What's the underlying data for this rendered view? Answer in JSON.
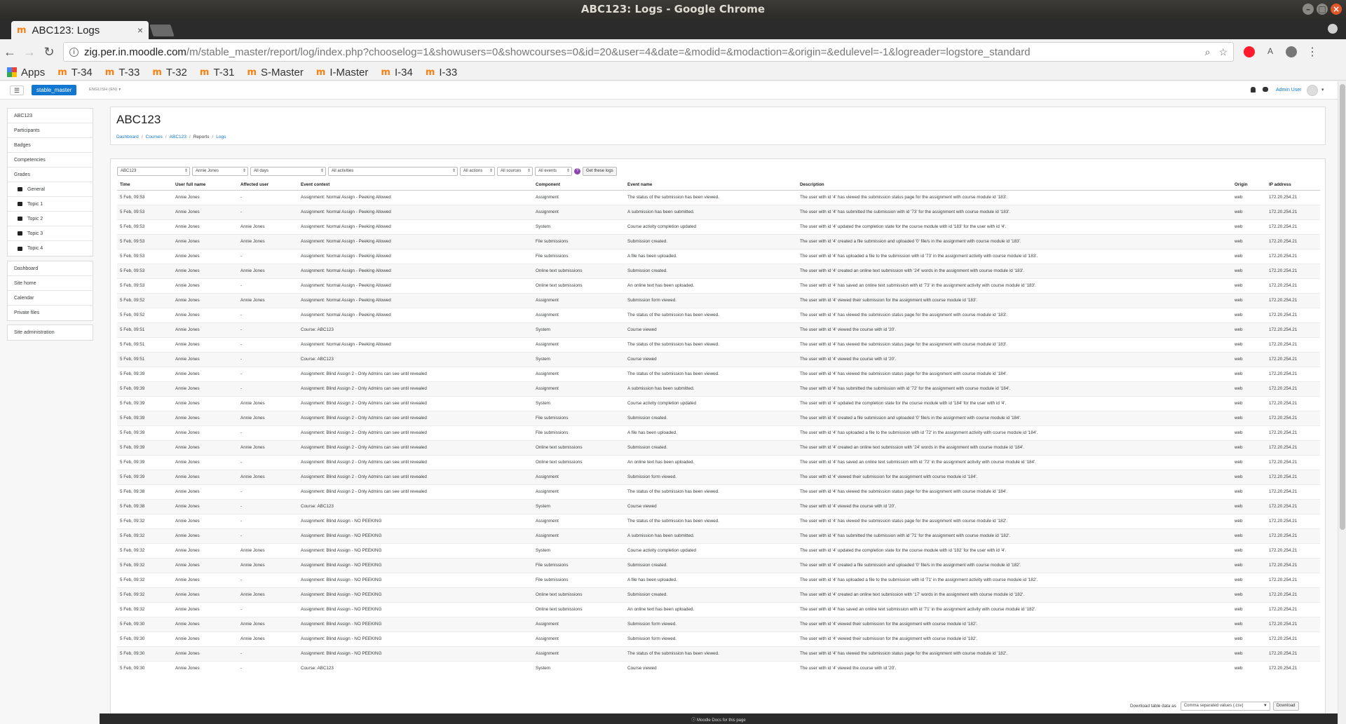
{
  "window": {
    "title": "ABC123: Logs - Google Chrome"
  },
  "tab": {
    "title": "ABC123: Logs",
    "favicon": "moodle-icon",
    "close": "×"
  },
  "toolbar": {
    "url_host": "zig.per.in.moodle.com",
    "url_path": "/m/stable_master/report/log/index.php?chooselog=1&showusers=0&showcourses=0&id=20&user=4&date=&modid=&modaction=&origin=&edulevel=-1&logreader=logstore_standard"
  },
  "bookmarks": [
    "T-34",
    "T-33",
    "T-32",
    "T-31",
    "S-Master",
    "I-Master",
    "I-34",
    "I-33"
  ],
  "bookmarks_apps": "Apps",
  "moodle": {
    "site_name": "stable_master",
    "language": "ENGLISH (EN)",
    "user": "Admin User"
  },
  "sidebar": {
    "course": [
      "ABC123",
      "Participants",
      "Badges",
      "Competencies",
      "Grades"
    ],
    "sections": [
      "General",
      "Topic 1",
      "Topic 2",
      "Topic 3",
      "Topic 4"
    ],
    "nav": [
      "Dashboard",
      "Site home",
      "Calendar",
      "Private files"
    ],
    "admin": "Site administration"
  },
  "header": {
    "title": "ABC123",
    "breadcrumb": [
      {
        "label": "Dashboard",
        "link": true
      },
      {
        "label": "Courses",
        "link": true
      },
      {
        "label": "ABC123",
        "link": true
      },
      {
        "label": "Reports",
        "link": false
      },
      {
        "label": "Logs",
        "link": true
      }
    ]
  },
  "filters": {
    "course": "ABC123",
    "user": "Annie Jones",
    "date": "All days",
    "activity": "All activities",
    "actions": "All actions",
    "sources": "All sources",
    "events": "All events",
    "submit": "Get these logs"
  },
  "table": {
    "columns": [
      "Time",
      "User full name",
      "Affected user",
      "Event context",
      "Component",
      "Event name",
      "Description",
      "Origin",
      "IP address"
    ],
    "rows": [
      [
        "5 Feb, 09:53",
        "Annie Jones",
        "-",
        "Assignment: Normal Assign - Peeking Allowed",
        "Assignment",
        "The status of the submission has been viewed.",
        "The user with id '4' has viewed the submission status page for the assignment with course module id '183'.",
        "web",
        "172.20.254.21"
      ],
      [
        "5 Feb, 09:53",
        "Annie Jones",
        "-",
        "Assignment: Normal Assign - Peeking Allowed",
        "Assignment",
        "A submission has been submitted.",
        "The user with id '4' has submitted the submission with id '73' for the assignment with course module id '183'.",
        "web",
        "172.20.254.21"
      ],
      [
        "5 Feb, 09:53",
        "Annie Jones",
        "Annie Jones",
        "Assignment: Normal Assign - Peeking Allowed",
        "System",
        "Course activity completion updated",
        "The user with id '4' updated the completion state for the course module with id '183' for the user with id '4'.",
        "web",
        "172.20.254.21"
      ],
      [
        "5 Feb, 09:53",
        "Annie Jones",
        "Annie Jones",
        "Assignment: Normal Assign - Peeking Allowed",
        "File submissions",
        "Submission created.",
        "The user with id '4' created a file submission and uploaded '0' file/s in the assignment with course module id '183'.",
        "web",
        "172.20.254.21"
      ],
      [
        "5 Feb, 09:53",
        "Annie Jones",
        "-",
        "Assignment: Normal Assign - Peeking Allowed",
        "File submissions",
        "A file has been uploaded.",
        "The user with id '4' has uploaded a file to the submission with id '73' in the assignment activity with course module id '183'.",
        "web",
        "172.20.254.21"
      ],
      [
        "5 Feb, 09:53",
        "Annie Jones",
        "Annie Jones",
        "Assignment: Normal Assign - Peeking Allowed",
        "Online text submissions",
        "Submission created.",
        "The user with id '4' created an online text submission with '24' words in the assignment with course module id '183'.",
        "web",
        "172.20.254.21"
      ],
      [
        "5 Feb, 09:53",
        "Annie Jones",
        "-",
        "Assignment: Normal Assign - Peeking Allowed",
        "Online text submissions",
        "An online text has been uploaded.",
        "The user with id '4' has saved an online text submission with id '73' in the assignment activity with course module id '183'.",
        "web",
        "172.20.254.21"
      ],
      [
        "5 Feb, 09:52",
        "Annie Jones",
        "Annie Jones",
        "Assignment: Normal Assign - Peeking Allowed",
        "Assignment",
        "Submission form viewed.",
        "The user with id '4' viewed their submission for the assignment with course module id '183'.",
        "web",
        "172.20.254.21"
      ],
      [
        "5 Feb, 09:52",
        "Annie Jones",
        "-",
        "Assignment: Normal Assign - Peeking Allowed",
        "Assignment",
        "The status of the submission has been viewed.",
        "The user with id '4' has viewed the submission status page for the assignment with course module id '183'.",
        "web",
        "172.20.254.21"
      ],
      [
        "5 Feb, 09:51",
        "Annie Jones",
        "-",
        "Course: ABC123",
        "System",
        "Course viewed",
        "The user with id '4' viewed the course with id '20'.",
        "web",
        "172.20.254.21"
      ],
      [
        "5 Feb, 09:51",
        "Annie Jones",
        "-",
        "Assignment: Normal Assign - Peeking Allowed",
        "Assignment",
        "The status of the submission has been viewed.",
        "The user with id '4' has viewed the submission status page for the assignment with course module id '183'.",
        "web",
        "172.20.254.21"
      ],
      [
        "5 Feb, 09:51",
        "Annie Jones",
        "-",
        "Course: ABC123",
        "System",
        "Course viewed",
        "The user with id '4' viewed the course with id '20'.",
        "web",
        "172.20.254.21"
      ],
      [
        "5 Feb, 09:39",
        "Annie Jones",
        "-",
        "Assignment: Blind Assign 2 - Only Admins can see until revealed",
        "Assignment",
        "The status of the submission has been viewed.",
        "The user with id '4' has viewed the submission status page for the assignment with course module id '184'.",
        "web",
        "172.20.254.21"
      ],
      [
        "5 Feb, 09:39",
        "Annie Jones",
        "-",
        "Assignment: Blind Assign 2 - Only Admins can see until revealed",
        "Assignment",
        "A submission has been submitted.",
        "The user with id '4' has submitted the submission with id '72' for the assignment with course module id '184'.",
        "web",
        "172.20.254.21"
      ],
      [
        "5 Feb, 09:39",
        "Annie Jones",
        "Annie Jones",
        "Assignment: Blind Assign 2 - Only Admins can see until revealed",
        "System",
        "Course activity completion updated",
        "The user with id '4' updated the completion state for the course module with id '184' for the user with id '4'.",
        "web",
        "172.20.254.21"
      ],
      [
        "5 Feb, 09:39",
        "Annie Jones",
        "Annie Jones",
        "Assignment: Blind Assign 2 - Only Admins can see until revealed",
        "File submissions",
        "Submission created.",
        "The user with id '4' created a file submission and uploaded '0' file/s in the assignment with course module id '184'.",
        "web",
        "172.20.254.21"
      ],
      [
        "5 Feb, 09:39",
        "Annie Jones",
        "-",
        "Assignment: Blind Assign 2 - Only Admins can see until revealed",
        "File submissions",
        "A file has been uploaded.",
        "The user with id '4' has uploaded a file to the submission with id '72' in the assignment activity with course module id '184'.",
        "web",
        "172.20.254.21"
      ],
      [
        "5 Feb, 09:39",
        "Annie Jones",
        "Annie Jones",
        "Assignment: Blind Assign 2 - Only Admins can see until revealed",
        "Online text submissions",
        "Submission created.",
        "The user with id '4' created an online text submission with '24' words in the assignment with course module id '184'.",
        "web",
        "172.20.254.21"
      ],
      [
        "5 Feb, 09:39",
        "Annie Jones",
        "-",
        "Assignment: Blind Assign 2 - Only Admins can see until revealed",
        "Online text submissions",
        "An online text has been uploaded.",
        "The user with id '4' has saved an online text submission with id '72' in the assignment activity with course module id '184'.",
        "web",
        "172.20.254.21"
      ],
      [
        "5 Feb, 09:39",
        "Annie Jones",
        "Annie Jones",
        "Assignment: Blind Assign 2 - Only Admins can see until revealed",
        "Assignment",
        "Submission form viewed.",
        "The user with id '4' viewed their submission for the assignment with course module id '184'.",
        "web",
        "172.20.254.21"
      ],
      [
        "5 Feb, 09:38",
        "Annie Jones",
        "-",
        "Assignment: Blind Assign 2 - Only Admins can see until revealed",
        "Assignment",
        "The status of the submission has been viewed.",
        "The user with id '4' has viewed the submission status page for the assignment with course module id '184'.",
        "web",
        "172.20.254.21"
      ],
      [
        "5 Feb, 09:38",
        "Annie Jones",
        "-",
        "Course: ABC123",
        "System",
        "Course viewed",
        "The user with id '4' viewed the course with id '20'.",
        "web",
        "172.20.254.21"
      ],
      [
        "5 Feb, 09:32",
        "Annie Jones",
        "-",
        "Assignment: Blind Assign - NO PEEKING",
        "Assignment",
        "The status of the submission has been viewed.",
        "The user with id '4' has viewed the submission status page for the assignment with course module id '182'.",
        "web",
        "172.20.254.21"
      ],
      [
        "5 Feb, 09:32",
        "Annie Jones",
        "-",
        "Assignment: Blind Assign - NO PEEKING",
        "Assignment",
        "A submission has been submitted.",
        "The user with id '4' has submitted the submission with id '71' for the assignment with course module id '182'.",
        "web",
        "172.20.254.21"
      ],
      [
        "5 Feb, 09:32",
        "Annie Jones",
        "Annie Jones",
        "Assignment: Blind Assign - NO PEEKING",
        "System",
        "Course activity completion updated",
        "The user with id '4' updated the completion state for the course module with id '182' for the user with id '4'.",
        "web",
        "172.20.254.21"
      ],
      [
        "5 Feb, 09:32",
        "Annie Jones",
        "Annie Jones",
        "Assignment: Blind Assign - NO PEEKING",
        "File submissions",
        "Submission created.",
        "The user with id '4' created a file submission and uploaded '0' file/s in the assignment with course module id '182'.",
        "web",
        "172.20.254.21"
      ],
      [
        "5 Feb, 09:32",
        "Annie Jones",
        "-",
        "Assignment: Blind Assign - NO PEEKING",
        "File submissions",
        "A file has been uploaded.",
        "The user with id '4' has uploaded a file to the submission with id '71' in the assignment activity with course module id '182'.",
        "web",
        "172.20.254.21"
      ],
      [
        "5 Feb, 09:32",
        "Annie Jones",
        "Annie Jones",
        "Assignment: Blind Assign - NO PEEKING",
        "Online text submissions",
        "Submission created.",
        "The user with id '4' created an online text submission with '17' words in the assignment with course module id '182'.",
        "web",
        "172.20.254.21"
      ],
      [
        "5 Feb, 09:32",
        "Annie Jones",
        "-",
        "Assignment: Blind Assign - NO PEEKING",
        "Online text submissions",
        "An online text has been uploaded.",
        "The user with id '4' has saved an online text submission with id '71' in the assignment activity with course module id '182'.",
        "web",
        "172.20.254.21"
      ],
      [
        "5 Feb, 09:30",
        "Annie Jones",
        "Annie Jones",
        "Assignment: Blind Assign - NO PEEKING",
        "Assignment",
        "Submission form viewed.",
        "The user with id '4' viewed their submission for the assignment with course module id '182'.",
        "web",
        "172.20.254.21"
      ],
      [
        "5 Feb, 09:30",
        "Annie Jones",
        "Annie Jones",
        "Assignment: Blind Assign - NO PEEKING",
        "Assignment",
        "Submission form viewed.",
        "The user with id '4' viewed their submission for the assignment with course module id '182'.",
        "web",
        "172.20.254.21"
      ],
      [
        "5 Feb, 09:30",
        "Annie Jones",
        "-",
        "Assignment: Blind Assign - NO PEEKING",
        "Assignment",
        "The status of the submission has been viewed.",
        "The user with id '4' has viewed the submission status page for the assignment with course module id '182'.",
        "web",
        "172.20.254.21"
      ],
      [
        "5 Feb, 09:30",
        "Annie Jones",
        "-",
        "Course: ABC123",
        "System",
        "Course viewed",
        "The user with id '4' viewed the course with id '20'.",
        "web",
        "172.20.254.21"
      ]
    ]
  },
  "download": {
    "label": "Download table data as",
    "format": "Comma separated values (.csv)",
    "button": "Download"
  },
  "footer": {
    "docs": "Moodle Docs for this page"
  }
}
